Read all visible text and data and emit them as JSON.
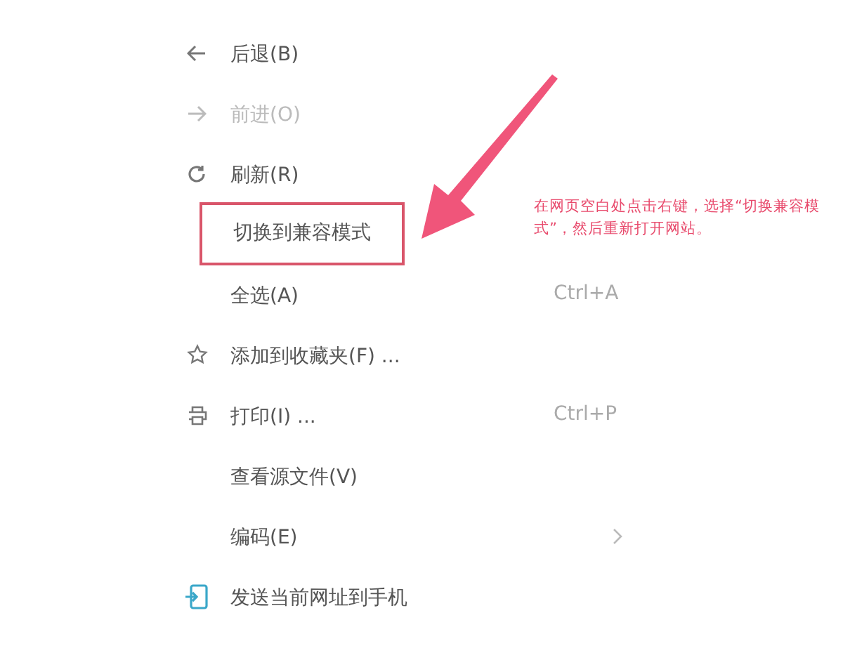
{
  "menu": {
    "items": [
      {
        "kind": "command",
        "label": "后退(B)",
        "disabled": false,
        "highlighted": false
      },
      {
        "kind": "command",
        "label": "前进(O)",
        "disabled": true,
        "highlighted": false
      },
      {
        "kind": "command",
        "label": "刷新(R)",
        "disabled": false,
        "highlighted": false
      },
      {
        "kind": "command",
        "label": "切换到兼容模式",
        "disabled": false,
        "highlighted": true
      },
      {
        "kind": "command",
        "label": "全选(A)",
        "shortcut": "Ctrl+A",
        "disabled": false,
        "highlighted": false
      },
      {
        "kind": "command",
        "label": "添加到收藏夹(F) ...",
        "disabled": false,
        "highlighted": false
      },
      {
        "kind": "command",
        "label": "打印(I) ...",
        "shortcut": "Ctrl+P",
        "disabled": false,
        "highlighted": false
      },
      {
        "kind": "command",
        "label": "查看源文件(V)",
        "disabled": false,
        "highlighted": false
      },
      {
        "kind": "submenu",
        "label": "编码(E)",
        "disabled": false,
        "highlighted": false
      },
      {
        "kind": "command",
        "label": "发送当前网址到手机",
        "disabled": false,
        "highlighted": false
      }
    ]
  },
  "annotation": {
    "text": "在网页空白处点击右键，选择“切换兼容模式”，然后重新打开网站。"
  }
}
